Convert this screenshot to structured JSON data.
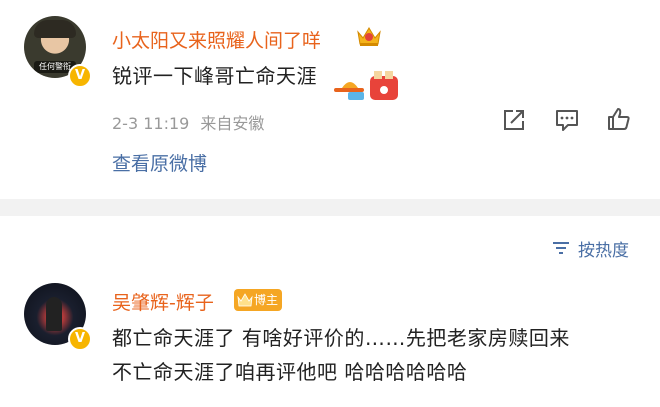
{
  "comments": [
    {
      "avatar_caption": "任何警衔",
      "username": "小太阳又来照耀人间了咩",
      "text": "锐评一下峰哥亡命天涯",
      "timestamp": "2-3 11:19",
      "location": "来自安徽",
      "view_original": "查看原微博"
    },
    {
      "username": "吴肇辉-辉子",
      "badge": "博主",
      "text_line1": "都亡命天涯了 有啥好评价的……先把老家房赎回来",
      "text_line2": "不亡命天涯了咱再评他吧 哈哈哈哈哈哈"
    }
  ],
  "sort": {
    "label": "按热度"
  },
  "colors": {
    "username": "#e8631c",
    "link": "#4a6fa5",
    "meta": "#999999",
    "separator": "#f2f2f2",
    "vip": "#f7b500"
  },
  "icons": [
    "crown-icon",
    "verified-icon",
    "share-icon",
    "comment-icon",
    "like-icon",
    "sort-icon"
  ]
}
